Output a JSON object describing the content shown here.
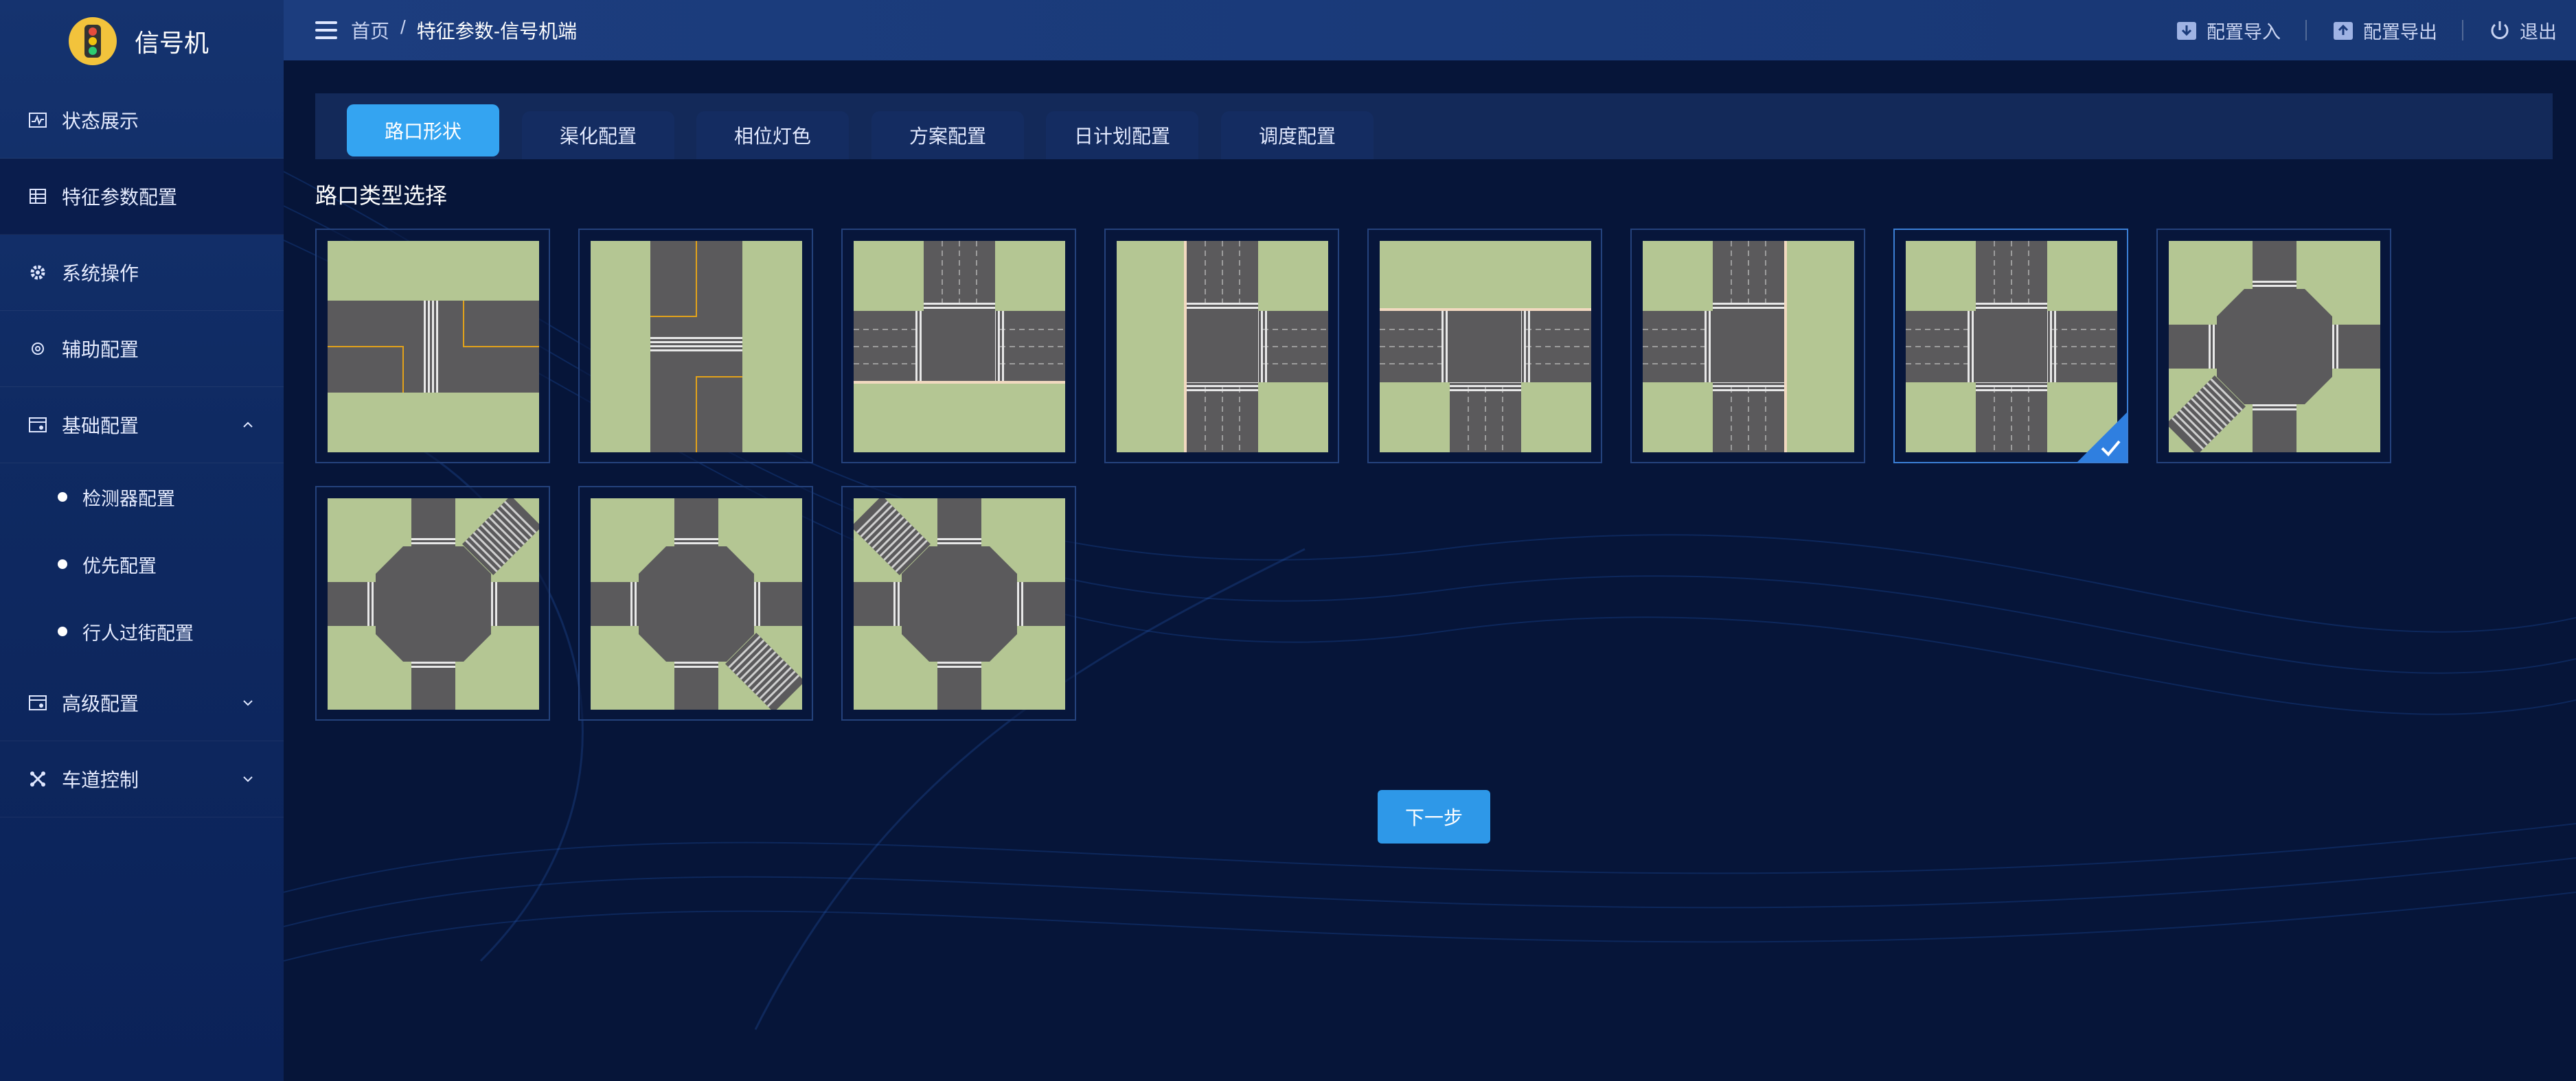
{
  "app": {
    "title": "信号机"
  },
  "sidebar": {
    "items": [
      {
        "label": "状态展示",
        "icon": "activity-icon"
      },
      {
        "label": "特征参数配置",
        "icon": "table-icon"
      },
      {
        "label": "系统操作",
        "icon": "gear-icon"
      },
      {
        "label": "辅助配置",
        "icon": "settings-cog-icon"
      },
      {
        "label": "基础配置",
        "icon": "config-icon",
        "expanded": true
      },
      {
        "label": "高级配置",
        "icon": "config-icon",
        "expanded": false
      },
      {
        "label": "车道控制",
        "icon": "lane-control-icon",
        "expanded": false
      }
    ],
    "sub_items": [
      "检测器配置",
      "优先配置",
      "行人过街配置"
    ]
  },
  "header": {
    "breadcrumb": {
      "home": "首页",
      "separator": "/",
      "current": "特征参数-信号机端"
    },
    "actions": {
      "import": "配置导入",
      "export": "配置导出",
      "logout": "退出"
    }
  },
  "tabs": [
    "路口形状",
    "渠化配置",
    "相位灯色",
    "方案配置",
    "日计划配置",
    "调度配置"
  ],
  "active_tab": "路口形状",
  "section_title": "路口类型选择",
  "intersections": [
    {
      "type": "straight-ew"
    },
    {
      "type": "straight-ns"
    },
    {
      "type": "t-missing-south"
    },
    {
      "type": "t-missing-west"
    },
    {
      "type": "t-missing-north"
    },
    {
      "type": "t-missing-east"
    },
    {
      "type": "cross",
      "selected": true
    },
    {
      "type": "octagon-branch-sw"
    },
    {
      "type": "octagon-branch-ne"
    },
    {
      "type": "octagon-branch-se"
    },
    {
      "type": "octagon-branch-nw"
    }
  ],
  "next_button": "下一步",
  "colors": {
    "accent": "#34a4f1",
    "grass": "#b4c693",
    "road": "#5b5a5c",
    "sidebar": "#12306b",
    "background": "#061539"
  }
}
